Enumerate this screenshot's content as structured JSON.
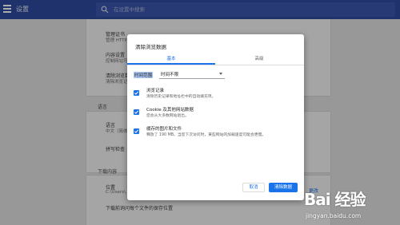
{
  "header": {
    "title": "设置",
    "search_placeholder": "在设置中搜索"
  },
  "background": {
    "cards": [
      {
        "items": [
          "管理证书",
          "管理 HTTPS/SSL 证书和设置",
          "内容设置",
          "控制网站可以使用的信息以及可向您显示的内容",
          "清除浏览数据",
          "清除浏览记录、Cookie、缓存及其他数据"
        ]
      }
    ],
    "section_language": "语言",
    "language_item": "语言",
    "language_value": "中文（简体）",
    "spellcheck": "拼写检查",
    "section_downloads": "下载内容",
    "location_label": "位置",
    "location_value": "C:\\Users\\...",
    "change_button": "更改",
    "ask_where_to_save": "下载前询问每个文件的保存位置"
  },
  "dialog": {
    "title": "清除浏览数据",
    "tabs": [
      "基本",
      "高级"
    ],
    "time_range_label": "时间范围",
    "time_range_value": "时间不限",
    "options": [
      {
        "title": "浏览记录",
        "desc": "清除历史记录和地址栏中的自动填充项。",
        "checked": true
      },
      {
        "title": "Cookie 及其他网站数据",
        "desc": "您会从大多数网站退出。",
        "checked": true
      },
      {
        "title": "缓存的图片和文件",
        "desc": "释放了 190 MB。当您下次访问时，某些网站的加载速度可能会更慢。",
        "checked": true
      }
    ],
    "cancel_label": "取消",
    "clear_label": "清除数据"
  },
  "watermark": {
    "brand": "Bai 经验",
    "url": "jingyan.baidu.com"
  },
  "colors": {
    "topbar": "#2f4a9e",
    "accent": "#1a73e8"
  }
}
